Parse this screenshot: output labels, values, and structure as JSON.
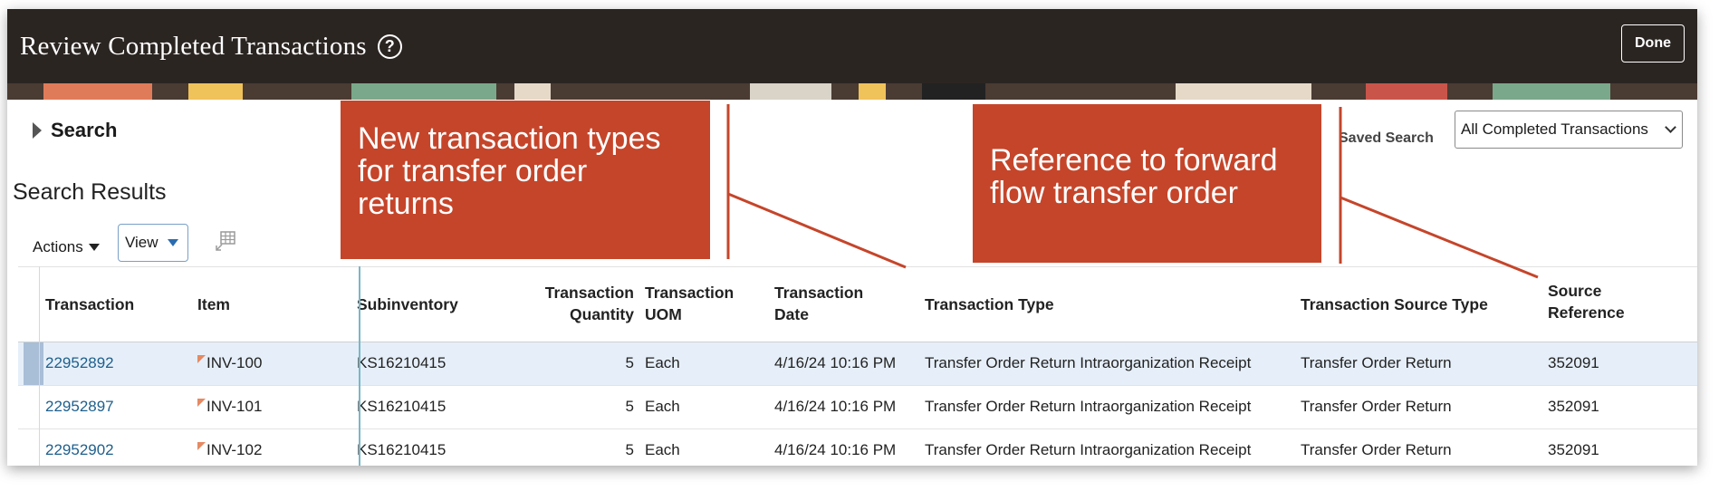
{
  "header": {
    "title": "Review Completed Transactions",
    "done_label": "Done"
  },
  "search": {
    "label": "Search",
    "saved_search_label": "Saved Search",
    "saved_search_value": "All Completed Transactions"
  },
  "results": {
    "title": "Search Results",
    "actions_label": "Actions",
    "view_label": "View"
  },
  "table": {
    "headers": {
      "transaction": "Transaction",
      "item": "Item",
      "subinventory": "Subinventory",
      "quantity_1": "Transaction",
      "quantity_2": "Quantity",
      "uom_1": "Transaction",
      "uom_2": "UOM",
      "date_1": "Transaction",
      "date_2": "Date",
      "type": "Transaction Type",
      "source_type": "Transaction Source Type",
      "source_ref_1": "Source",
      "source_ref_2": "Reference"
    },
    "rows": [
      {
        "transaction": "22952892",
        "item": "INV-100",
        "subinventory": "KS16210415",
        "quantity": "5",
        "uom": "Each",
        "date": "4/16/24 10:16 PM",
        "type": "Transfer Order Return Intraorganization Receipt",
        "source_type": "Transfer Order Return",
        "source_ref": "352091"
      },
      {
        "transaction": "22952897",
        "item": "INV-101",
        "subinventory": "KS16210415",
        "quantity": "5",
        "uom": "Each",
        "date": "4/16/24 10:16 PM",
        "type": "Transfer Order Return Intraorganization Receipt",
        "source_type": "Transfer Order Return",
        "source_ref": "352091"
      },
      {
        "transaction": "22952902",
        "item": "INV-102",
        "subinventory": "KS16210415",
        "quantity": "5",
        "uom": "Each",
        "date": "4/16/24 10:16 PM",
        "type": "Transfer Order Return Intraorganization Receipt",
        "source_type": "Transfer Order Return",
        "source_ref": "352091"
      }
    ]
  },
  "callouts": {
    "left_1": "New transaction types",
    "left_2": "for transfer order",
    "left_3": "returns",
    "right_1": "Reference to forward",
    "right_2": "flow transfer order"
  },
  "colors": {
    "header_bg": "#2b2522",
    "callout": "#c5452a",
    "link": "#1e5f8c",
    "row_selected": "#e6eff9"
  }
}
